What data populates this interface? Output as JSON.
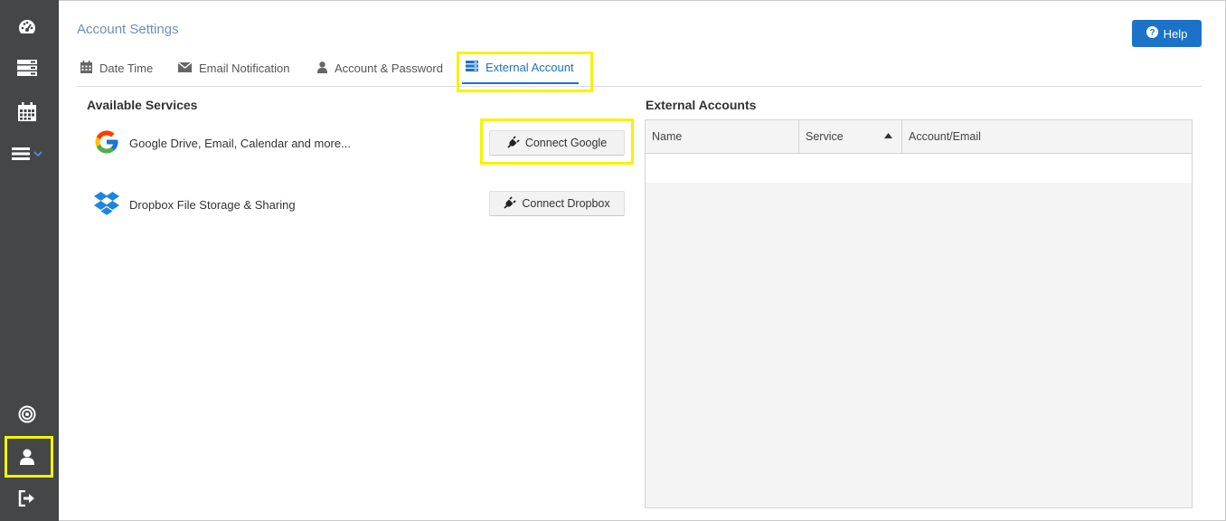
{
  "sidebar": {
    "items": [
      {
        "name": "dashboard"
      },
      {
        "name": "storage"
      },
      {
        "name": "calendar"
      },
      {
        "name": "menu"
      },
      {
        "name": "target"
      },
      {
        "name": "user"
      },
      {
        "name": "logout"
      }
    ]
  },
  "header": {
    "title": "Account Settings",
    "help_label": "Help"
  },
  "tabs": [
    {
      "label": "Date Time",
      "icon": "calendar-icon"
    },
    {
      "label": "Email Notification",
      "icon": "envelope-icon"
    },
    {
      "label": "Account & Password",
      "icon": "user-icon"
    },
    {
      "label": "External Account",
      "icon": "server-icon",
      "active": true
    }
  ],
  "available_services": {
    "title": "Available Services",
    "items": [
      {
        "label": "Google Drive, Email, Calendar and more...",
        "button": "Connect Google"
      },
      {
        "label": "Dropbox File Storage & Sharing",
        "button": "Connect Dropbox"
      }
    ]
  },
  "external_accounts": {
    "title": "External Accounts",
    "columns": [
      "Name",
      "Service",
      "Account/Email"
    ]
  },
  "colors": {
    "sidebar_bg": "#444648",
    "accent": "#1a73c9",
    "highlight": "#f7f300"
  }
}
